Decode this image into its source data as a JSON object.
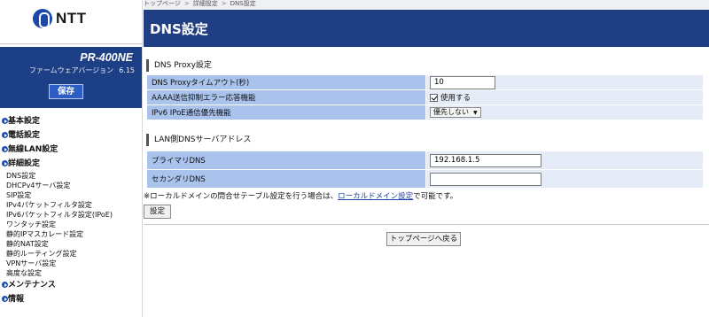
{
  "logo": {
    "text": "NTT"
  },
  "model": {
    "name": "PR-400NE",
    "fw_label": "ファームウェアバージョン",
    "fw_version": "6.15"
  },
  "save_label": "保存",
  "menu": {
    "basic": "基本設定",
    "phone": "電話設定",
    "wlan": "無線LAN設定",
    "detail": "詳細設定",
    "detail_items": [
      "DNS設定",
      "DHCPv4サーバ設定",
      "SIP設定",
      "IPv4パケットフィルタ設定",
      "IPv6パケットフィルタ設定(IPoE)",
      "ワンタッチ設定",
      "静的IPマスカレード設定",
      "静的NAT設定",
      "静的ルーティング設定",
      "VPNサーバ設定",
      "高度な設定"
    ],
    "maintenance": "メンテナンス",
    "info": "情報"
  },
  "breadcrumb": [
    "トップページ",
    "詳細設定",
    "DNS設定"
  ],
  "breadcrumb_sep": ">",
  "page_title": "DNS設定",
  "dns_proxy": {
    "heading": "DNS Proxy設定",
    "timeout_label": "DNS Proxyタイムアウト(秒)",
    "timeout_value": "10",
    "aaaa_label": "AAAA送信抑制エラー応答機能",
    "aaaa_checked": true,
    "aaaa_option": "使用する",
    "ipv6_label": "IPv6 IPoE通信優先機能",
    "ipv6_value": "優先しない"
  },
  "lan_dns": {
    "heading": "LAN側DNSサーバアドレス",
    "primary_label": "プライマリDNS",
    "primary_value": "192.168.1.5",
    "secondary_label": "セカンダリDNS",
    "secondary_value": ""
  },
  "note": {
    "before": "※ローカルドメインの問合せテーブル設定を行う場合は、",
    "link": "ローカルドメイン設定",
    "after": "で可能です。"
  },
  "set_button": "設定",
  "top_button": "トップページへ戻る"
}
